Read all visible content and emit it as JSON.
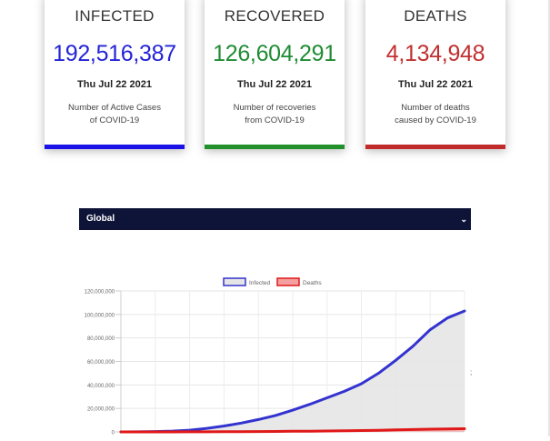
{
  "cards": [
    {
      "title": "INFECTED",
      "value": "192,516,387",
      "date": "Thu Jul 22 2021",
      "desc_line1": "Number of Active Cases",
      "desc_line2": "of COVID-19",
      "color": "#2323d6",
      "bar": "#1a12e6"
    },
    {
      "title": "RECOVERED",
      "value": "126,604,291",
      "date": "Thu Jul 22 2021",
      "desc_line1": "Number of recoveries",
      "desc_line2": "from COVID-19",
      "color": "#1f8c33",
      "bar": "#22912c"
    },
    {
      "title": "DEATHS",
      "value": "4,134,948",
      "date": "Thu Jul 22 2021",
      "desc_line1": "Number of deaths",
      "desc_line2": "caused by COVID-19",
      "color": "#c23030",
      "bar": "#c22b2b"
    }
  ],
  "region_select": {
    "selected": "Global"
  },
  "stray_text": ";",
  "chart_data": {
    "type": "line",
    "title": "",
    "xlabel": "",
    "ylabel": "",
    "ylim": [
      0,
      120000000
    ],
    "yticks": [
      "120,000,000",
      "100,000,000",
      "80,000,000",
      "60,000,000",
      "40,000,000",
      "20,000,000",
      "0"
    ],
    "grid": true,
    "legend_position": "top",
    "series": [
      {
        "name": "Infected",
        "color": "#3333d0",
        "fill": "#e5e5e5",
        "values": [
          0,
          100000,
          300000,
          700000,
          1500000,
          3000000,
          5000000,
          7500000,
          10500000,
          14000000,
          18500000,
          23500000,
          29000000,
          34500000,
          41000000,
          50000000,
          61000000,
          73000000,
          87000000,
          97000000,
          103000000
        ]
      },
      {
        "name": "Deaths",
        "color": "#e01818",
        "fill": "#f5a0a0",
        "values": [
          0,
          5000,
          15000,
          35000,
          60000,
          100000,
          160000,
          230000,
          310000,
          400000,
          520000,
          650000,
          800000,
          960000,
          1150000,
          1400000,
          1700000,
          2000000,
          2300000,
          2550000,
          2700000
        ]
      }
    ]
  }
}
